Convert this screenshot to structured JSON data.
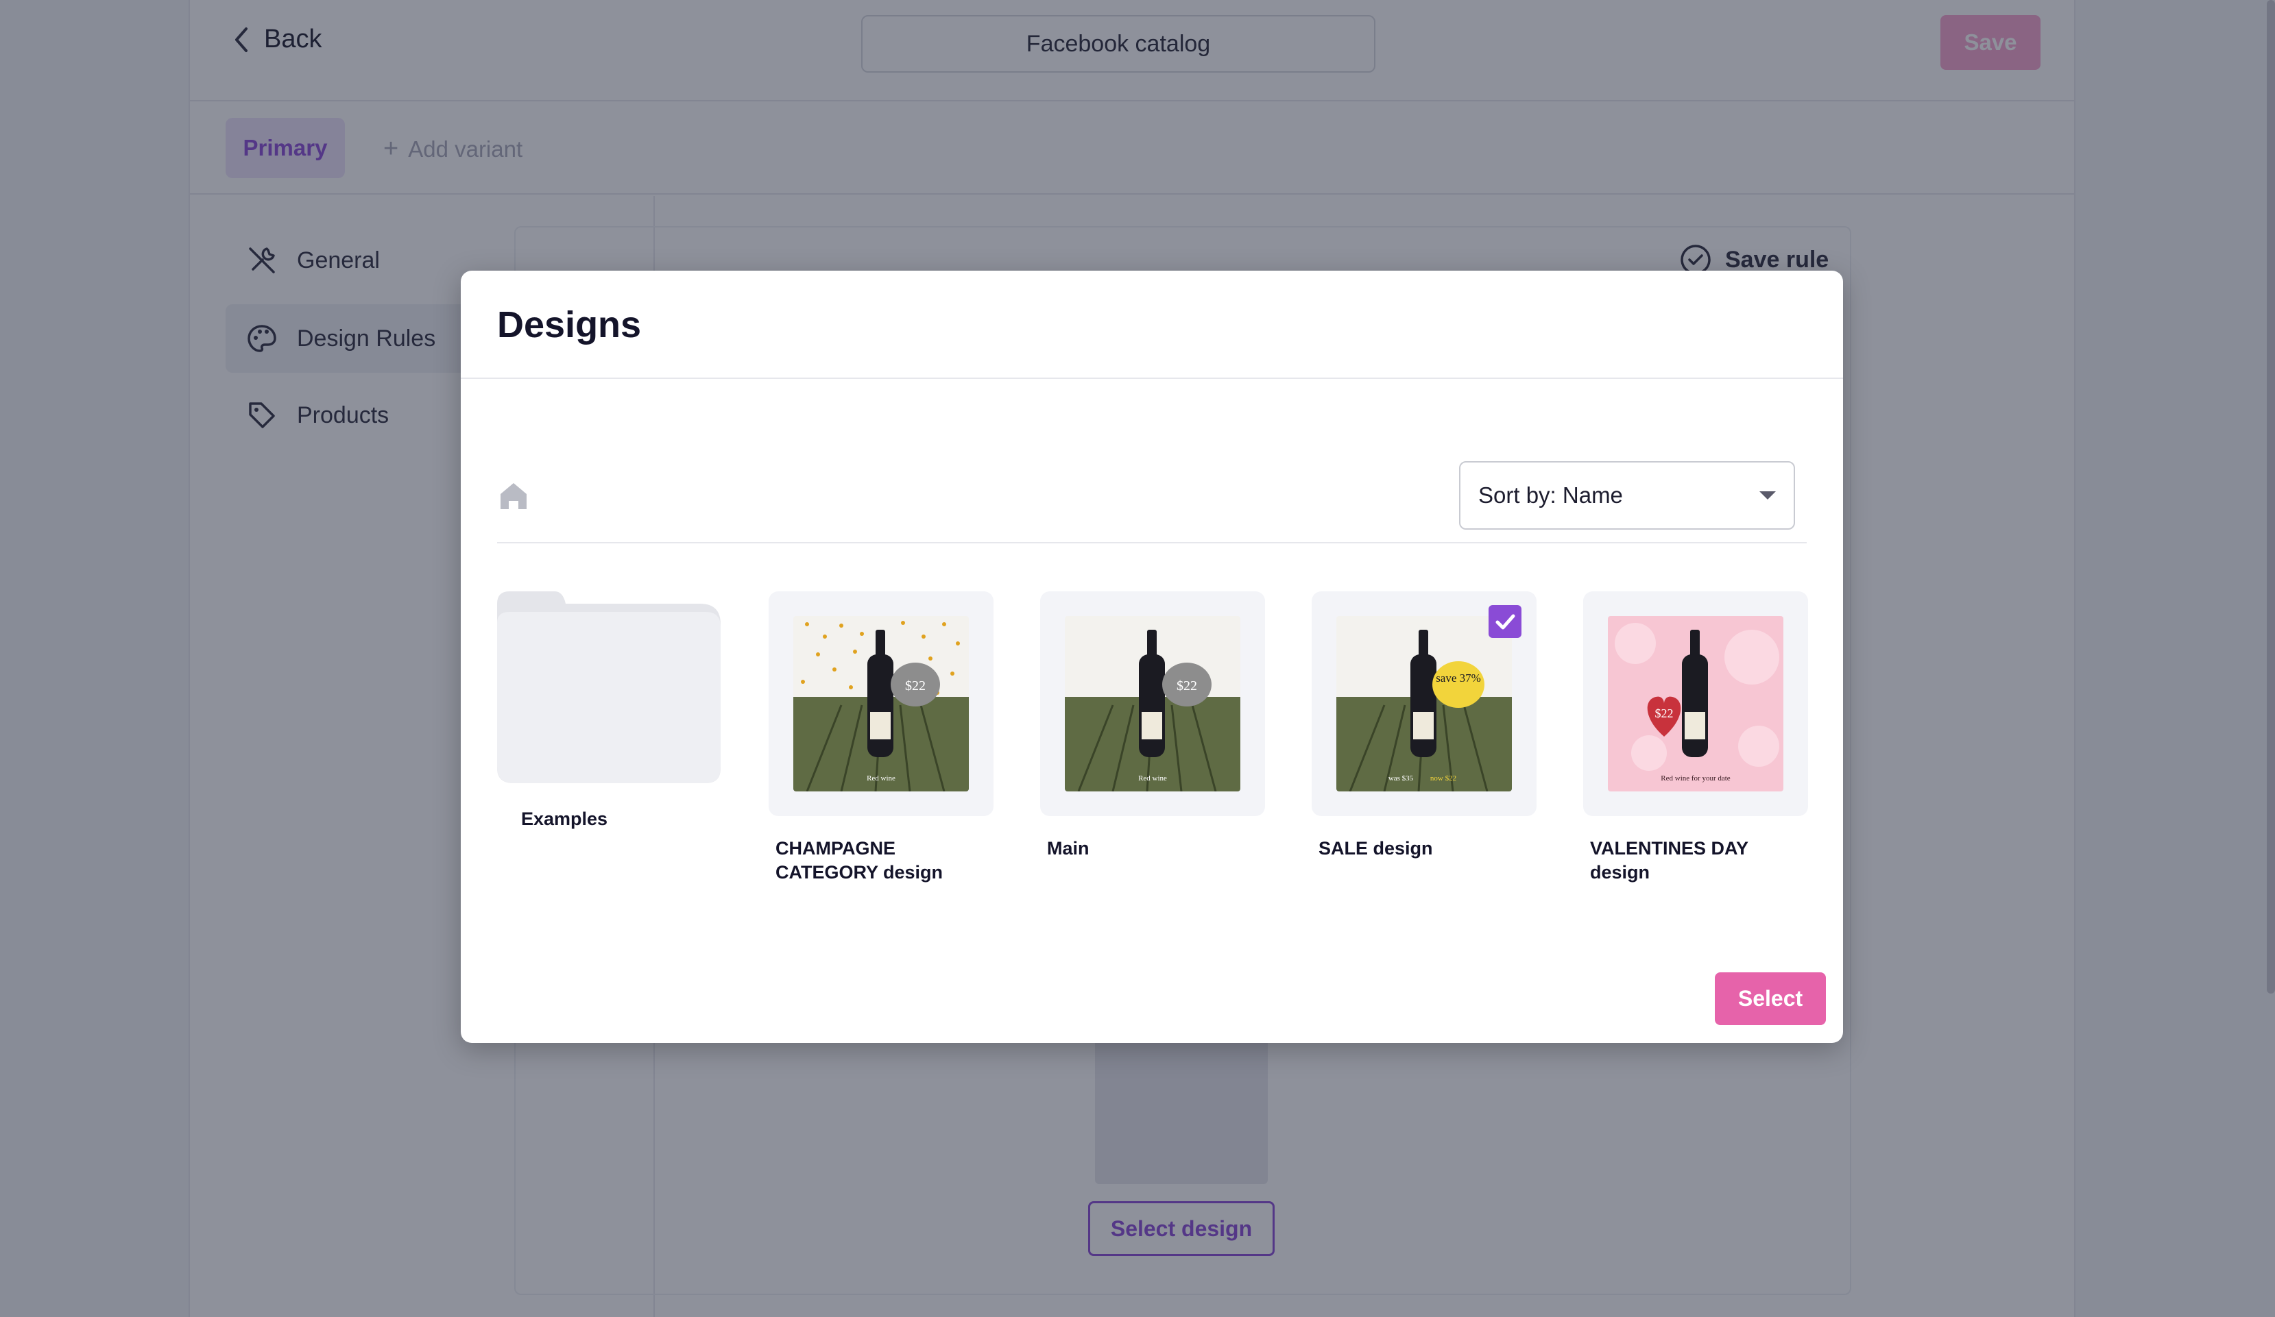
{
  "header": {
    "back_label": "Back",
    "catalog_title": "Facebook catalog",
    "save_label": "Save"
  },
  "variants": {
    "primary_label": "Primary",
    "add_variant_label": "Add variant"
  },
  "sidebar": {
    "items": [
      {
        "label": "General",
        "icon": "tools-icon"
      },
      {
        "label": "Design Rules",
        "icon": "palette-icon"
      },
      {
        "label": "Products",
        "icon": "tag-icon"
      }
    ]
  },
  "main": {
    "save_rule_label": "Save rule",
    "select_design_label": "Select design"
  },
  "modal": {
    "title": "Designs",
    "sort_label": "Sort by: Name",
    "tiles": [
      {
        "label": "Examples",
        "type": "folder"
      },
      {
        "label": "CHAMPAGNE CATEGORY design",
        "type": "design",
        "price": "$22",
        "caption": "Red wine",
        "selected": false
      },
      {
        "label": "Main",
        "type": "design",
        "price": "$22",
        "caption": "Red wine",
        "selected": false
      },
      {
        "label": "SALE design",
        "type": "design",
        "badge": "save 37%",
        "caption_was": "was $35",
        "caption_now": "now $22",
        "selected": true
      },
      {
        "label": "VALENTINES DAY design",
        "type": "design",
        "price": "$22",
        "caption": "Red wine for your date",
        "selected": false
      }
    ],
    "select_label": "Select"
  },
  "colors": {
    "accent": "#8a4bd6",
    "primary_button": "#e663aa",
    "save_button_disabled": "#f7a4cf"
  }
}
